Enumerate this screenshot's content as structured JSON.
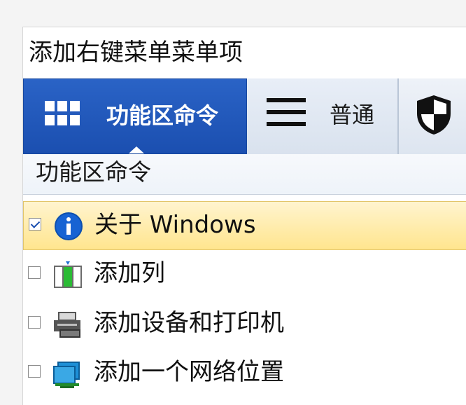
{
  "window": {
    "title": "添加右键菜单菜单项"
  },
  "tabs": [
    {
      "label": "功能区命令",
      "icon": "grid-icon",
      "active": true
    },
    {
      "label": "普通",
      "icon": "menu-icon",
      "active": false
    },
    {
      "label": "",
      "icon": "shield-icon",
      "active": false
    }
  ],
  "section": {
    "title": "功能区命令"
  },
  "items": [
    {
      "label": "关于 Windows",
      "checked": true,
      "icon": "info-icon"
    },
    {
      "label": "添加列",
      "checked": false,
      "icon": "add-column-icon"
    },
    {
      "label": "添加设备和打印机",
      "checked": false,
      "icon": "printer-icon"
    },
    {
      "label": "添加一个网络位置",
      "checked": false,
      "icon": "network-location-icon"
    }
  ],
  "colors": {
    "active_tab": "#1b4fb0",
    "tab_bar": "#dbe4f0",
    "highlight": "#ffe58e"
  }
}
